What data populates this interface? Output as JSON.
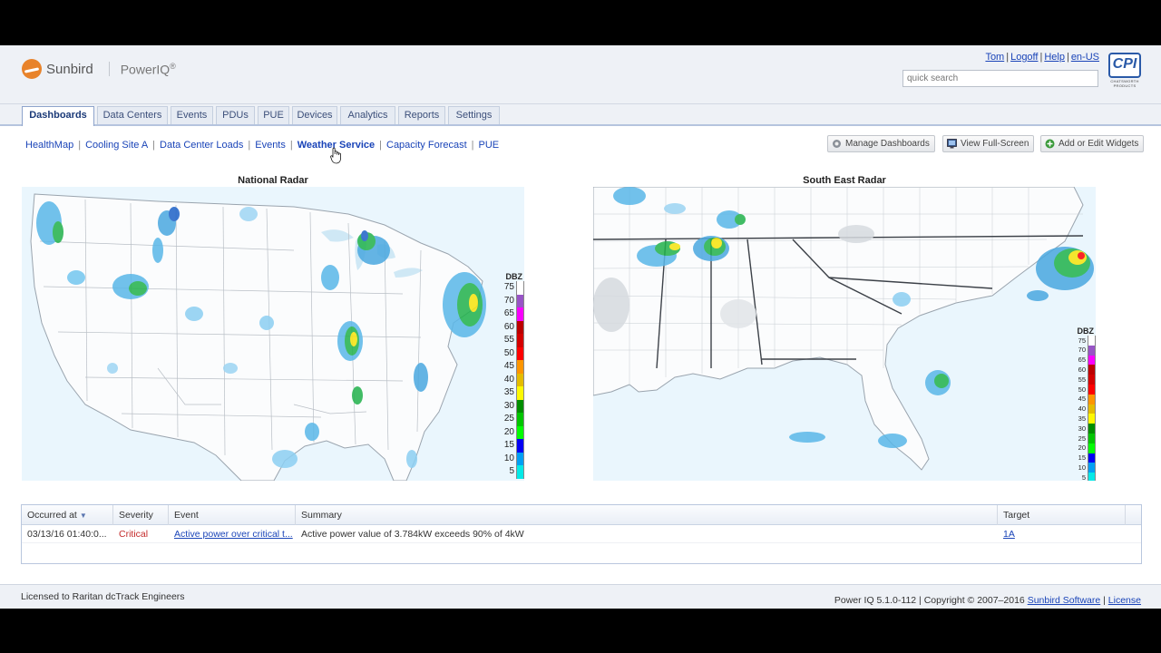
{
  "header": {
    "brand": "Sunbird",
    "product": "PowerIQ",
    "product_mark": "®",
    "user_links": [
      "Tom",
      "Logoff",
      "Help",
      "en-US"
    ],
    "search_placeholder": "quick search",
    "partner_logo_text": "CPI",
    "partner_logo_caption": "CHATSWORTH PRODUCTS"
  },
  "tabs": [
    {
      "label": "Dashboards",
      "active": true
    },
    {
      "label": "Data Centers"
    },
    {
      "label": "Events"
    },
    {
      "label": "PDUs"
    },
    {
      "label": "PUE"
    },
    {
      "label": "Devices"
    },
    {
      "label": "Analytics"
    },
    {
      "label": "Reports"
    },
    {
      "label": "Settings"
    }
  ],
  "dashboard_links": [
    {
      "label": "HealthMap"
    },
    {
      "label": "Cooling Site A"
    },
    {
      "label": "Data Center Loads"
    },
    {
      "label": "Events"
    },
    {
      "label": "Weather Service",
      "active": true
    },
    {
      "label": "Capacity Forecast"
    },
    {
      "label": "PUE"
    }
  ],
  "actions": {
    "manage": "Manage Dashboards",
    "fullscreen": "View Full-Screen",
    "widgets": "Add or Edit Widgets"
  },
  "radars": {
    "national": {
      "title": "National Radar",
      "legend_title": "DBZ",
      "legend_levels": [
        "75",
        "70",
        "65",
        "60",
        "55",
        "50",
        "45",
        "40",
        "35",
        "30",
        "25",
        "20",
        "15",
        "10",
        "5"
      ]
    },
    "southeast": {
      "title": "South East Radar",
      "legend_title": "DBZ",
      "legend_levels": [
        "75",
        "70",
        "65",
        "60",
        "55",
        "50",
        "45",
        "40",
        "35",
        "30",
        "25",
        "20",
        "15",
        "10",
        "5"
      ]
    },
    "legend_colors": [
      "#ffffff",
      "#9854c6",
      "#f800fd",
      "#bc0000",
      "#d40000",
      "#fd0000",
      "#fd9500",
      "#e5bc00",
      "#fdf802",
      "#008e00",
      "#01c501",
      "#02fd02",
      "#0300f4",
      "#019ff4",
      "#04e9e7"
    ]
  },
  "events": {
    "columns": [
      "Occurred at",
      "Severity",
      "Event",
      "Summary",
      "Target"
    ],
    "rows": [
      {
        "occurred": "03/13/16 01:40:0...",
        "severity": "Critical",
        "event": "Active power over critical t...",
        "summary": "Active power value of 3.784kW exceeds 90% of 4kW",
        "target": "1A"
      }
    ]
  },
  "footer": {
    "license": "Licensed to Raritan dcTrack Engineers",
    "version": "Power IQ 5.1.0-112 | Copyright © 2007–2016",
    "company": "Sunbird Software",
    "license_link": "License"
  }
}
